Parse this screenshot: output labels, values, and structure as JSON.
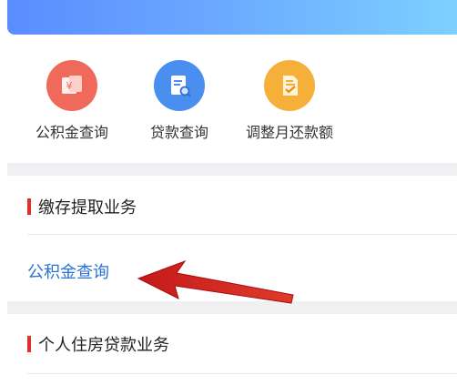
{
  "quick_actions": [
    {
      "label": "公积金查询",
      "icon": "yuan-card-icon",
      "color": "#ef6a5a"
    },
    {
      "label": "贷款查询",
      "icon": "document-search-icon",
      "color": "#4a8ff0"
    },
    {
      "label": "调整月还款额",
      "icon": "document-check-icon",
      "color": "#f6b03a"
    }
  ],
  "sections": [
    {
      "title": "缴存提取业务",
      "items": [
        "公积金查询"
      ]
    },
    {
      "title": "个人住房贷款业务"
    }
  ],
  "accent_color": "#e0302a",
  "link_color": "#2a72d4"
}
